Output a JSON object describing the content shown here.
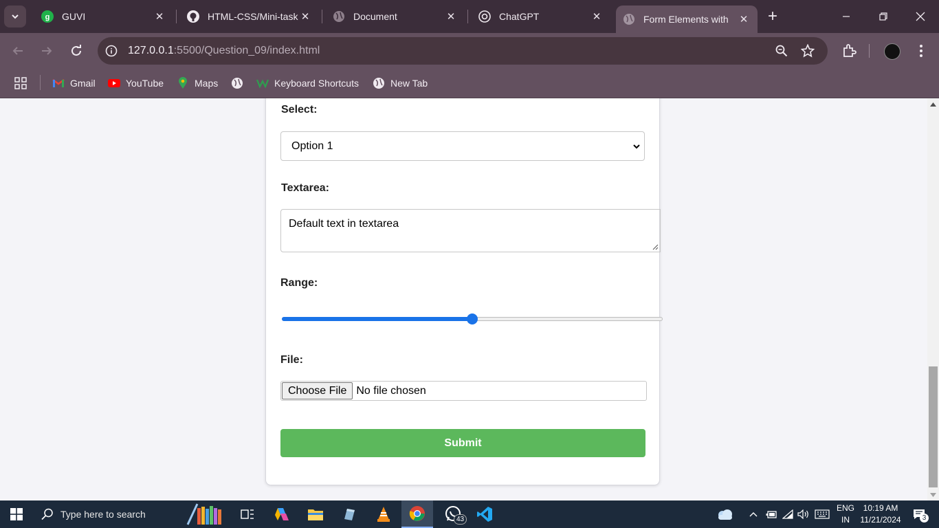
{
  "browser": {
    "tabs": [
      {
        "title": "GUVI",
        "icon": "guvi-icon"
      },
      {
        "title": "HTML-CSS/Mini-task",
        "icon": "github-icon"
      },
      {
        "title": "Document",
        "icon": "globe-icon"
      },
      {
        "title": "ChatGPT",
        "icon": "chatgpt-icon"
      },
      {
        "title": "Form Elements with",
        "icon": "globe-icon",
        "active": true
      }
    ],
    "new_tab": "+",
    "url_host": "127.0.0.1",
    "url_rest": ":5500/Question_09/index.html",
    "bookmarks": [
      {
        "label": "Gmail",
        "icon": "gmail-icon"
      },
      {
        "label": "YouTube",
        "icon": "youtube-icon"
      },
      {
        "label": "Maps",
        "icon": "maps-icon"
      },
      {
        "label": "",
        "icon": "globe-icon"
      },
      {
        "label": "Keyboard Shortcuts",
        "icon": "w-icon"
      },
      {
        "label": "New Tab",
        "icon": "globe-icon"
      }
    ]
  },
  "form": {
    "select_label": "Select:",
    "select_value": "Option 1",
    "textarea_label": "Textarea:",
    "textarea_value": "Default text in textarea",
    "range_label": "Range:",
    "range_value": 0.5,
    "file_label": "File:",
    "file_button": "Choose File",
    "file_status": "No file chosen",
    "submit_label": "Submit"
  },
  "taskbar": {
    "search_placeholder": "Type here to search",
    "whatsapp_badge": "43",
    "language": "ENG",
    "region": "IN",
    "time": "10:19 AM",
    "date": "11/21/2024",
    "notification_count": "3"
  },
  "colors": {
    "tabstrip": "#3b2d3a",
    "toolbar": "#63505f",
    "submit": "#5cb85c",
    "range_accent": "#1a73e8",
    "taskbar": "#1c2a3b"
  }
}
